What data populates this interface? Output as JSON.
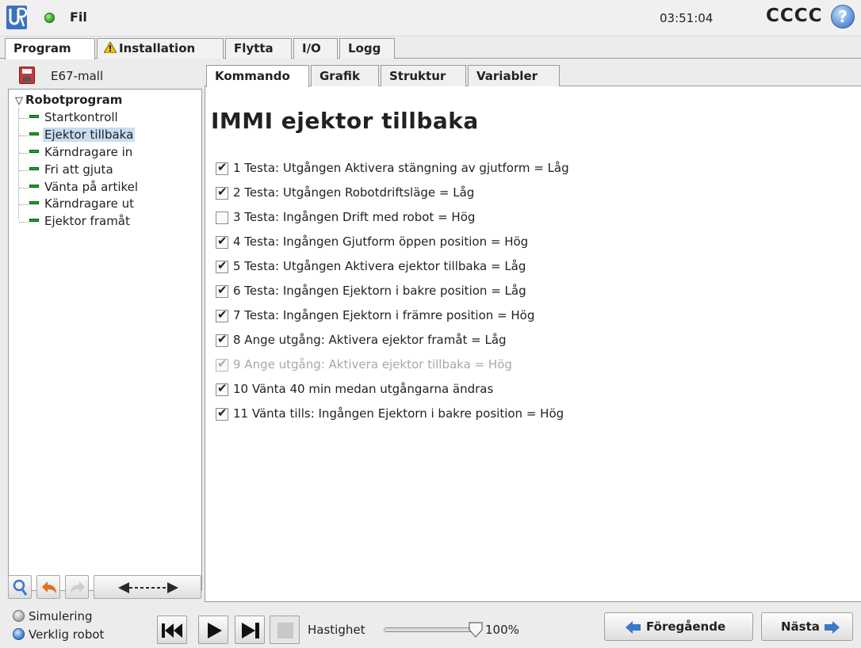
{
  "header": {
    "file_menu": "Fil",
    "clock": "03:51:04",
    "robot_name": "CCCC",
    "help": "?"
  },
  "main_tabs": [
    "Program",
    "Installation",
    "Flytta",
    "I/O",
    "Logg"
  ],
  "program": {
    "name": "E67-mall",
    "tree_root": "Robotprogram",
    "tree_items": [
      {
        "label": "Startkontroll",
        "selected": false
      },
      {
        "label": "Ejektor tillbaka",
        "selected": true
      },
      {
        "label": "Kärndragare in",
        "selected": false
      },
      {
        "label": "Fri att gjuta",
        "selected": false
      },
      {
        "label": "Vänta på artikel",
        "selected": false
      },
      {
        "label": "Kärndragare ut",
        "selected": false
      },
      {
        "label": "Ejektor framåt",
        "selected": false
      }
    ]
  },
  "sub_tabs": [
    "Kommando",
    "Grafik",
    "Struktur",
    "Variabler"
  ],
  "node": {
    "title": "IMMI ejektor tillbaka",
    "items": [
      {
        "text": "1 Testa: Utgången Aktivera stängning av gjutform = Låg",
        "checked": true,
        "enabled": true
      },
      {
        "text": "2 Testa: Utgången Robotdriftsläge = Låg",
        "checked": true,
        "enabled": true
      },
      {
        "text": "3 Testa: Ingången Drift med robot = Hög",
        "checked": false,
        "enabled": true
      },
      {
        "text": "4 Testa: Ingången Gjutform öppen position = Hög",
        "checked": true,
        "enabled": true
      },
      {
        "text": "5 Testa: Utgången Aktivera ejektor tillbaka = Låg",
        "checked": true,
        "enabled": true
      },
      {
        "text": "6 Testa: Ingången Ejektorn i bakre position = Låg",
        "checked": true,
        "enabled": true
      },
      {
        "text": "7 Testa: Ingången Ejektorn i främre position = Hög",
        "checked": true,
        "enabled": true
      },
      {
        "text": "8 Ange utgång: Aktivera ejektor framåt = Låg",
        "checked": true,
        "enabled": true
      },
      {
        "text": "9 Ange utgång: Aktivera ejektor tillbaka = Hög",
        "checked": true,
        "enabled": false
      },
      {
        "text": "10 Vänta 40 min medan utgångarna ändras",
        "checked": true,
        "enabled": true
      },
      {
        "text": "11 Vänta tills: Ingången Ejektorn i bakre position = Hög",
        "checked": true,
        "enabled": true
      }
    ]
  },
  "footer": {
    "mode_simulation": "Simulering",
    "mode_real": "Verklig robot",
    "selected_mode": "Verklig robot",
    "speed_label": "Hastighet",
    "speed_value": "100%",
    "speed_fraction": 1.0,
    "prev_label": "Föregående",
    "next_label": "Nästa"
  },
  "colors": {
    "status_ok": "#2d9a1c",
    "selection": "#c9dcf3",
    "nav_arrow": "#3a78c8",
    "undo_arrow": "#e07020",
    "warning": "#f2c200"
  }
}
